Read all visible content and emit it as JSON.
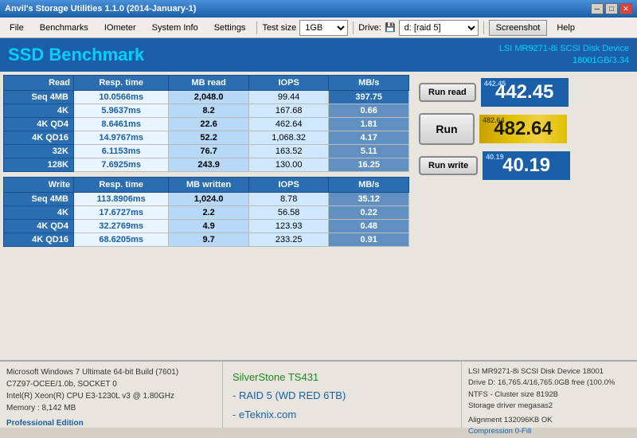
{
  "titleBar": {
    "title": "Anvil's Storage Utilities 1.1.0 (2014-January-1)",
    "minBtn": "─",
    "maxBtn": "□",
    "closeBtn": "✕"
  },
  "menuBar": {
    "items": [
      "File",
      "Benchmarks",
      "IOmeter",
      "System Info",
      "Settings"
    ],
    "testSizeLabel": "Test size",
    "testSizeValue": "1GB",
    "driveLabel": "Drive:",
    "driveIcon": "💾",
    "driveValue": "d: [raid 5]",
    "screenshotLabel": "Screenshot",
    "helpLabel": "Help"
  },
  "header": {
    "title": "SSD Benchmark",
    "deviceName": "LSI MR9271-8i SCSI Disk Device",
    "deviceSize": "18001GB/3.34"
  },
  "readTable": {
    "headers": [
      "Read",
      "Resp. time",
      "MB read",
      "IOPS",
      "MB/s"
    ],
    "rows": [
      {
        "label": "Seq 4MB",
        "resp": "10.0566ms",
        "mb": "2,048.0",
        "iops": "99.44",
        "mbs": "397.75"
      },
      {
        "label": "4K",
        "resp": "5.9637ms",
        "mb": "8.2",
        "iops": "167.68",
        "mbs": "0.66"
      },
      {
        "label": "4K QD4",
        "resp": "8.6461ms",
        "mb": "22.6",
        "iops": "462.64",
        "mbs": "1.81"
      },
      {
        "label": "4K QD16",
        "resp": "14.9767ms",
        "mb": "52.2",
        "iops": "1,068.32",
        "mbs": "4.17"
      },
      {
        "label": "32K",
        "resp": "6.1153ms",
        "mb": "76.7",
        "iops": "163.52",
        "mbs": "5.11"
      },
      {
        "label": "128K",
        "resp": "7.6925ms",
        "mb": "243.9",
        "iops": "130.00",
        "mbs": "16.25"
      }
    ]
  },
  "writeTable": {
    "headers": [
      "Write",
      "Resp. time",
      "MB written",
      "IOPS",
      "MB/s"
    ],
    "rows": [
      {
        "label": "Seq 4MB",
        "resp": "113.8906ms",
        "mb": "1,024.0",
        "iops": "8.78",
        "mbs": "35.12"
      },
      {
        "label": "4K",
        "resp": "17.6727ms",
        "mb": "2.2",
        "iops": "56.58",
        "mbs": "0.22"
      },
      {
        "label": "4K QD4",
        "resp": "32.2769ms",
        "mb": "4.9",
        "iops": "123.93",
        "mbs": "0.48"
      },
      {
        "label": "4K QD16",
        "resp": "68.6205ms",
        "mb": "9.7",
        "iops": "233.25",
        "mbs": "0.91"
      }
    ]
  },
  "rightPanel": {
    "runReadLabel": "Run read",
    "runLabel": "Run",
    "runWriteLabel": "Run write",
    "readScore": "442.45",
    "readScoreLabel": "442.45",
    "totalScore": "482.64",
    "totalScoreLabel": "482.64",
    "writeScore": "40.19",
    "writeScoreLabel": "40.19"
  },
  "footer": {
    "left": {
      "line1": "Microsoft Windows 7 Ultimate  64-bit Build (7601)",
      "line2": "C7Z97-OCEE/1.0b, SOCKET 0",
      "line3": "Intel(R) Xeon(R) CPU E3-1230L v3 @ 1.80GHz",
      "line4": "Memory : 8,142 MB",
      "proEdition": "Professional Edition"
    },
    "center": {
      "brand": "SilverStone TS431",
      "line1": "- RAID 5 (WD RED 6TB)",
      "line2": "- eTeknix.com"
    },
    "right": {
      "line1": "LSI MR9271-8i SCSI Disk Device 18001",
      "line2": "Drive D: 16,765.4/16,765.0GB free (100.0%",
      "line3": "NTFS - Cluster size 8192B",
      "line4": "Storage driver  megasas2",
      "line5": "",
      "line6": "Alignment 132096KB OK",
      "line7": "Compression 0-Fill"
    }
  }
}
